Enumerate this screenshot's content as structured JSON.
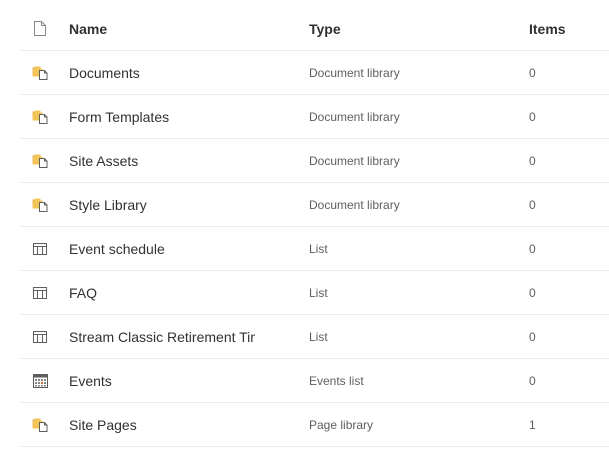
{
  "header": {
    "icon": "file-type-icon",
    "name": "Name",
    "type": "Type",
    "items": "Items"
  },
  "rows": [
    {
      "icon": "document-library-icon",
      "name": "Documents",
      "type": "Document library",
      "items": "0"
    },
    {
      "icon": "document-library-icon",
      "name": "Form Templates",
      "type": "Document library",
      "items": "0"
    },
    {
      "icon": "document-library-icon",
      "name": "Site Assets",
      "type": "Document library",
      "items": "0"
    },
    {
      "icon": "document-library-icon",
      "name": "Style Library",
      "type": "Document library",
      "items": "0"
    },
    {
      "icon": "list-icon",
      "name": "Event schedule",
      "type": "List",
      "items": "0"
    },
    {
      "icon": "list-icon",
      "name": "FAQ",
      "type": "List",
      "items": "0"
    },
    {
      "icon": "list-icon",
      "name": "Stream Classic Retirement Tim",
      "type": "List",
      "items": "0"
    },
    {
      "icon": "calendar-icon",
      "name": "Events",
      "type": "Events list",
      "items": "0"
    },
    {
      "icon": "document-library-icon",
      "name": "Site Pages",
      "type": "Page library",
      "items": "1"
    }
  ],
  "colors": {
    "library_folder": "#f2c45a",
    "library_page": "#ffffff",
    "icon_stroke": "#605e5c",
    "calendar_accent": "#d8722f",
    "divider": "#edebe9"
  }
}
